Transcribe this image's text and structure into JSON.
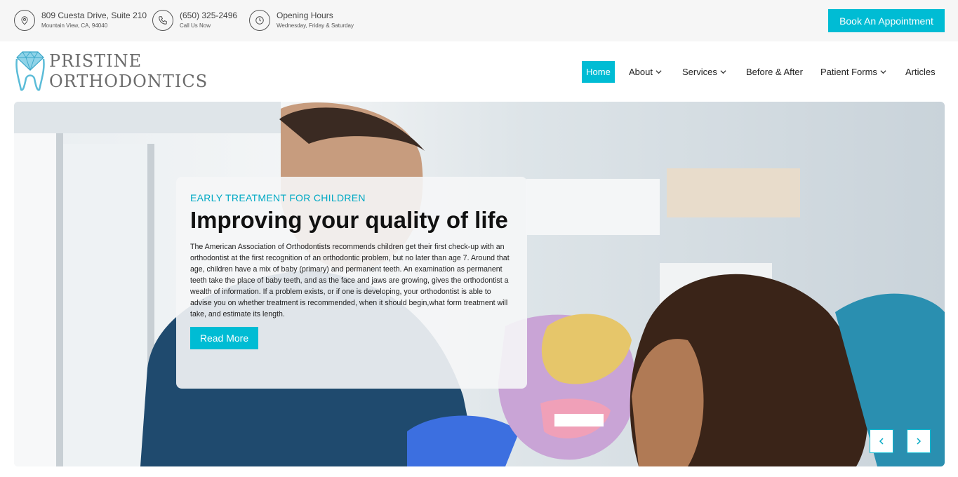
{
  "topbar": {
    "address": {
      "icon": "map-pin-icon",
      "line1": "809 Cuesta Drive, Suite 210",
      "line2": "Mountain View, CA, 94040"
    },
    "phone": {
      "icon": "phone-icon",
      "line1": "(650) 325-2496",
      "line2": "Call Us Now"
    },
    "hours": {
      "icon": "clock-icon",
      "line1": "Opening Hours",
      "line2": "Wednesday, Friday & Saturday"
    },
    "book_label": "Book An Appointment"
  },
  "logo": {
    "line1": "PRISTINE",
    "line2": "ORTHODONTICS"
  },
  "nav": {
    "items": [
      {
        "label": "Home",
        "active": true,
        "dropdown": false
      },
      {
        "label": "About",
        "active": false,
        "dropdown": true
      },
      {
        "label": "Services",
        "active": false,
        "dropdown": true
      },
      {
        "label": "Before & After",
        "active": false,
        "dropdown": false
      },
      {
        "label": "Patient Forms",
        "active": false,
        "dropdown": true
      },
      {
        "label": "Articles",
        "active": false,
        "dropdown": false
      }
    ]
  },
  "hero": {
    "eyebrow": "EARLY TREATMENT FOR CHILDREN",
    "headline": "Improving your quality of life",
    "body": "The American Association of Orthodontists recommends children get their first check-up with an orthodontist at the first recognition of an orthodontic problem, but no later than age 7. Around that age, children have a mix of baby (primary) and permanent teeth. An examination as permanent teeth take the place of baby teeth, and as the face and jaws are growing, gives the orthodontist a wealth of information. If a problem exists, or if one is developing, your orthodontist is able to advise you on whether treatment is recommended, when it should begin,what form treatment will take, and estimate its length.",
    "cta_label": "Read More",
    "prev_icon": "chevron-left-icon",
    "next_icon": "chevron-right-icon"
  },
  "colors": {
    "accent": "#00bcd4",
    "topbar_bg": "#f6f6f6"
  }
}
